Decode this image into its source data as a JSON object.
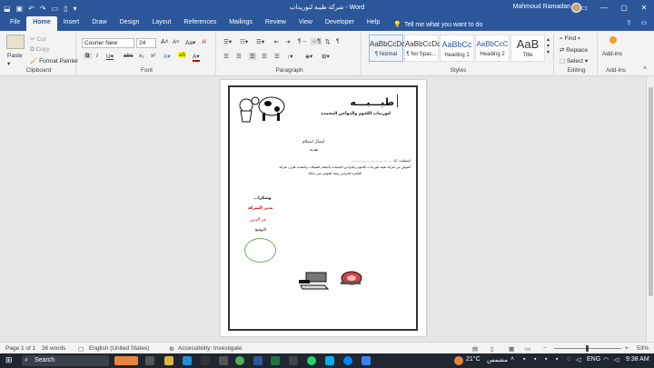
{
  "title_bar": {
    "document_title": "شركة طيبة لتوريدات - Word",
    "user_name": "Mahmoud Ramadan"
  },
  "tabs": [
    "File",
    "Home",
    "Insert",
    "Draw",
    "Design",
    "Layout",
    "References",
    "Mailings",
    "Review",
    "View",
    "Developer",
    "Help"
  ],
  "active_tab": "Home",
  "tell_me": "Tell me what you want to do",
  "ribbon": {
    "clipboard": {
      "paste": "Paste",
      "cut": "Cut",
      "copy": "Copy",
      "format_painter": "Format Painter",
      "label": "Clipboard"
    },
    "font": {
      "family": "Courier New",
      "size": "24",
      "label": "Font"
    },
    "paragraph": {
      "label": "Paragraph"
    },
    "styles": {
      "items": [
        {
          "sample": "AaBbCcDc",
          "name": "¶ Normal"
        },
        {
          "sample": "AaBbCcDc",
          "name": "¶ No Spac..."
        },
        {
          "sample": "AaBbCc",
          "name": "Heading 1"
        },
        {
          "sample": "AaBbCcC",
          "name": "Heading 2"
        },
        {
          "sample": "AaB",
          "name": "Title"
        }
      ],
      "label": "Styles"
    },
    "editing": {
      "find": "Find",
      "replace": "Replace",
      "select": "Select",
      "label": "Editing"
    },
    "addins": {
      "button": "Add-ins",
      "label": "Add-ins"
    }
  },
  "document": {
    "company_name": "طيـــبـــه",
    "company_subtitle": "لتوريدات اللحوم والدواجن المجمدة",
    "receipt_title": "ايصال استلام",
    "receipt_type": "نقدية",
    "received_from": "استلمت انا.....................................",
    "body_line1": "العوض من شركة طيبة لتوريدات اللحوم والدواجن المجمدة بأستلام الشيكات والنقدية طرف شركة",
    "body_line2": "القاهرة للدواجن وهذا للعوض مني بذالك",
    "thanks": "وشكرا...",
    "manager_title": "مدير الشركة",
    "manager_name": "عز الدين",
    "signature_label": "التوقيع"
  },
  "status_bar": {
    "page": "Page 1 of 1",
    "words": "36 words",
    "language": "English (United States)",
    "accessibility": "Accessibility: Investigate",
    "zoom": "53%"
  },
  "taskbar": {
    "search": "Search",
    "weather": "21°C",
    "weather_desc": "مشمس",
    "lang": "ENG",
    "time": "9:38 AM"
  }
}
